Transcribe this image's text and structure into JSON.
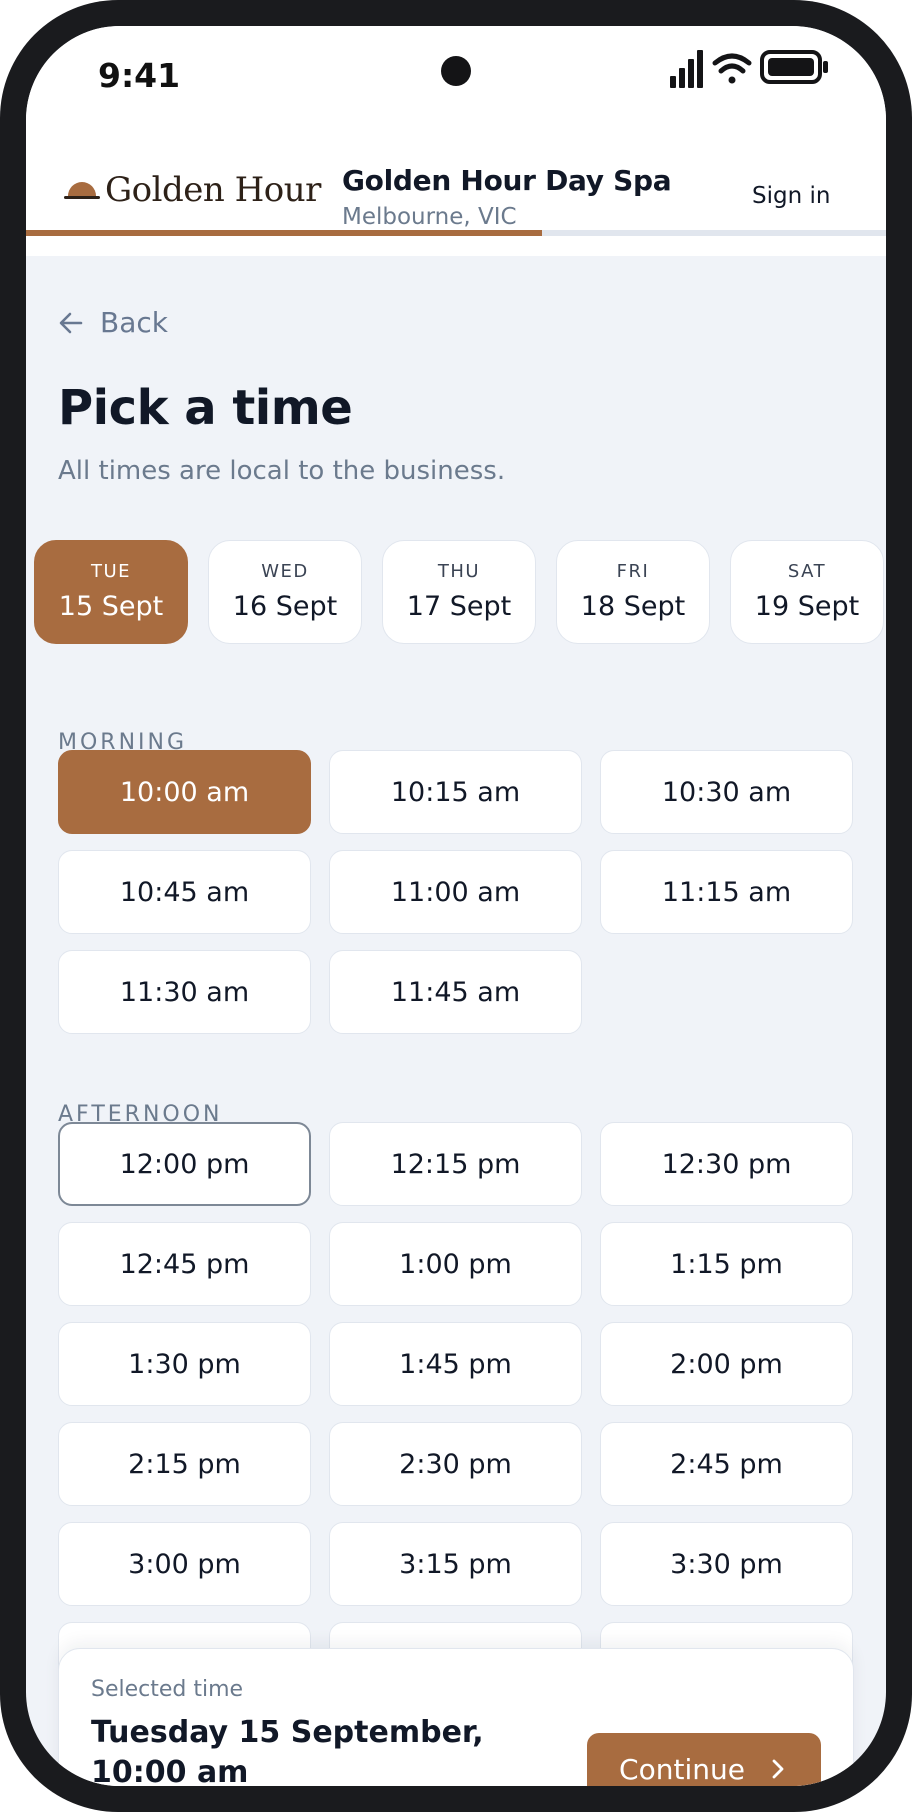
{
  "status_bar": {
    "time": "9:41"
  },
  "header": {
    "logo_text": "Golden Hour",
    "business_name": "Golden Hour Day Spa",
    "location": "Melbourne, VIC",
    "sign_in": "Sign in",
    "progress_fraction": 0.6
  },
  "page": {
    "back_label": "Back",
    "title": "Pick a time",
    "subtitle": "All times are local to the business."
  },
  "days": [
    {
      "dow": "TUE",
      "date": "15 Sept",
      "selected": true
    },
    {
      "dow": "WED",
      "date": "16 Sept",
      "selected": false
    },
    {
      "dow": "THU",
      "date": "17 Sept",
      "selected": false
    },
    {
      "dow": "FRI",
      "date": "18 Sept",
      "selected": false
    },
    {
      "dow": "SAT",
      "date": "19 Sept",
      "selected": false
    }
  ],
  "morning": {
    "label": "MORNING",
    "slots": [
      "10:00 am",
      "10:15 am",
      "10:30 am",
      "10:45 am",
      "11:00 am",
      "11:15 am",
      "11:30 am",
      "11:45 am"
    ],
    "selected_index": 0
  },
  "afternoon": {
    "label": "AFTERNOON",
    "slots": [
      "12:00 pm",
      "12:15 pm",
      "12:30 pm",
      "12:45 pm",
      "1:00 pm",
      "1:15 pm",
      "1:30 pm",
      "1:45 pm",
      "2:00 pm",
      "2:15 pm",
      "2:30 pm",
      "2:45 pm",
      "3:00 pm",
      "3:15 pm",
      "3:30 pm",
      "",
      "",
      ""
    ],
    "focused_index": 0
  },
  "footer": {
    "selected_label": "Selected time",
    "selected_value": "Tuesday 15 September, 10:00 am",
    "continue_label": "Continue"
  },
  "colors": {
    "accent": "#a86c40",
    "background": "#f0f3f8",
    "text": "#111827",
    "muted": "#6b7a8d"
  }
}
